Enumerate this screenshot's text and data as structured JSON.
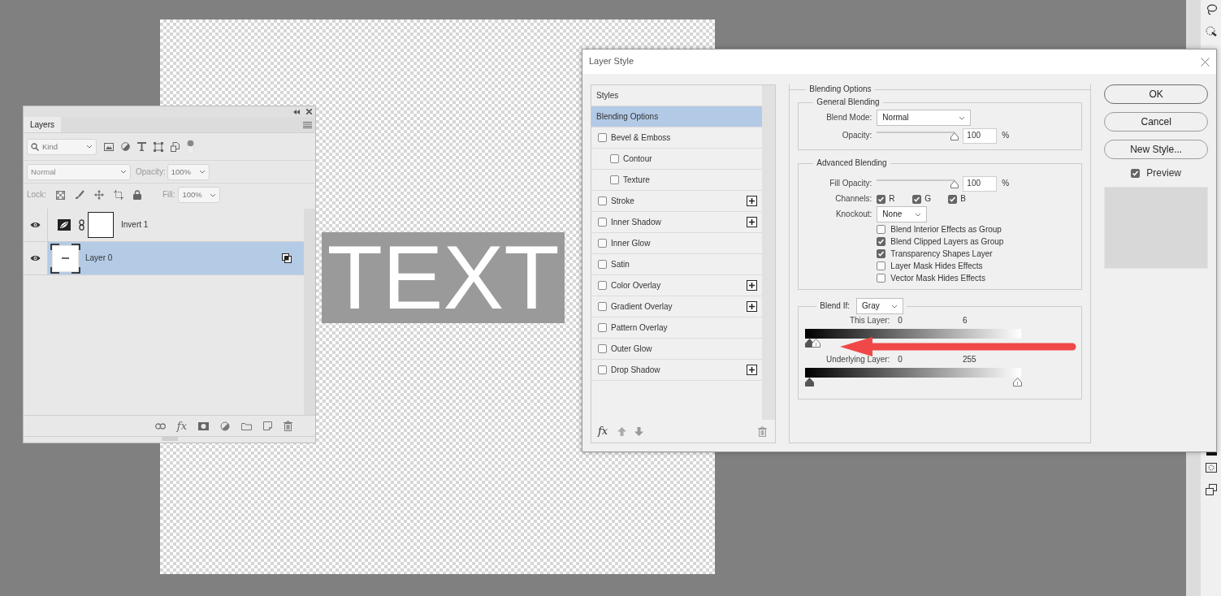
{
  "canvas": {
    "text": "TEXT"
  },
  "layers_panel": {
    "tab": "Layers",
    "filter": {
      "placeholder": "Kind",
      "on": true
    },
    "blend_mode": "Normal",
    "opacity_label": "Opacity:",
    "opacity": "100%",
    "lock_label": "Lock:",
    "fill_label": "Fill:",
    "fill": "100%",
    "layers": [
      {
        "name": "Invert 1",
        "kind": "adjustment",
        "visible": true,
        "selected": false
      },
      {
        "name": "Layer 0",
        "kind": "smart",
        "visible": true,
        "selected": true
      }
    ],
    "footer_fx": "fx"
  },
  "layer_style": {
    "title": "Layer Style",
    "styles": [
      {
        "label": "Styles",
        "kind": "heading",
        "selected": false
      },
      {
        "label": "Blending Options",
        "kind": "heading",
        "selected": true
      },
      {
        "label": "Bevel & Emboss",
        "kind": "effect",
        "checked": false,
        "selected": false,
        "addable": false,
        "children": [
          {
            "label": "Contour",
            "kind": "effect",
            "checked": false,
            "selected": false,
            "addable": false
          },
          {
            "label": "Texture",
            "kind": "effect",
            "checked": false,
            "selected": false,
            "addable": false
          }
        ]
      },
      {
        "label": "Stroke",
        "kind": "effect",
        "checked": false,
        "selected": false,
        "addable": true
      },
      {
        "label": "Inner Shadow",
        "kind": "effect",
        "checked": false,
        "selected": false,
        "addable": true
      },
      {
        "label": "Inner Glow",
        "kind": "effect",
        "checked": false,
        "selected": false,
        "addable": false
      },
      {
        "label": "Satin",
        "kind": "effect",
        "checked": false,
        "selected": false,
        "addable": false
      },
      {
        "label": "Color Overlay",
        "kind": "effect",
        "checked": false,
        "selected": false,
        "addable": true
      },
      {
        "label": "Gradient Overlay",
        "kind": "effect",
        "checked": false,
        "selected": false,
        "addable": true
      },
      {
        "label": "Pattern Overlay",
        "kind": "effect",
        "checked": false,
        "selected": false,
        "addable": false
      },
      {
        "label": "Outer Glow",
        "kind": "effect",
        "checked": false,
        "selected": false,
        "addable": false
      },
      {
        "label": "Drop Shadow",
        "kind": "effect",
        "checked": false,
        "selected": false,
        "addable": true
      }
    ],
    "footer_fx": "fx",
    "blending_options": {
      "title": "Blending Options",
      "general": {
        "title": "General Blending",
        "blend_mode": {
          "label": "Blend Mode:",
          "value": "Normal"
        },
        "opacity": {
          "label": "Opacity:",
          "value": "100",
          "unit": "%",
          "level": 1
        }
      },
      "advanced": {
        "title": "Advanced Blending",
        "fill_opacity": {
          "label": "Fill Opacity:",
          "value": "100",
          "unit": "%",
          "level": 1
        },
        "channels": {
          "label": "Channels:",
          "items": [
            {
              "label": "R",
              "checked": true
            },
            {
              "label": "G",
              "checked": true
            },
            {
              "label": "B",
              "checked": true
            }
          ]
        },
        "knockout": {
          "label": "Knockout:",
          "value": "None"
        },
        "options": [
          {
            "label": "Blend Interior Effects as Group",
            "checked": false
          },
          {
            "label": "Blend Clipped Layers as Group",
            "checked": true
          },
          {
            "label": "Transparency Shapes Layer",
            "checked": true
          },
          {
            "label": "Layer Mask Hides Effects",
            "checked": false
          },
          {
            "label": "Vector Mask Hides Effects",
            "checked": false
          }
        ]
      },
      "blend_if": {
        "label": "Blend If:",
        "value": "Gray",
        "this_layer": {
          "label": "This Layer:",
          "low": "0",
          "high": "6",
          "low_thumb": {
            "level": 0
          },
          "high_thumb": {
            "level": 0.03
          }
        },
        "underlying_layer": {
          "label": "Underlying Layer:",
          "low": "0",
          "high": "255",
          "low_thumb": {
            "level": 0
          },
          "high_thumb": {
            "level": 1
          }
        }
      }
    },
    "buttons": [
      {
        "label": "OK",
        "kind": "default"
      },
      {
        "label": "Cancel",
        "kind": "normal"
      },
      {
        "label": "New Style...",
        "kind": "normal"
      }
    ],
    "preview": {
      "label": "Preview",
      "checked": true
    }
  }
}
